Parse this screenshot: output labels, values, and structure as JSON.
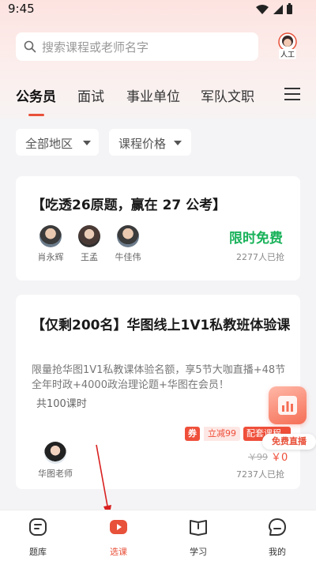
{
  "status_bar": {
    "time": "9:45"
  },
  "search": {
    "placeholder": "搜索课程或老师名字"
  },
  "customer_service": {
    "label": "人工"
  },
  "tabs": [
    {
      "label": "公务员",
      "active": true
    },
    {
      "label": "面试"
    },
    {
      "label": "事业单位"
    },
    {
      "label": "军队文职"
    }
  ],
  "filters": {
    "region": "全部地区",
    "price": "课程价格"
  },
  "card1": {
    "title": "【吃透26原题，赢在 27 公考】",
    "teachers": [
      "肖永辉",
      "王孟",
      "牛佳伟"
    ],
    "price_label": "限时免费",
    "sold": "2277人已抢"
  },
  "card2": {
    "title": "【仅剩200名】华图线上1V1私教班体验课",
    "description": "限量抢华图1V1私教课体验名额，享5节大咖直播+48节全年时政+4000政治理论题+华图在会员！",
    "hours": "共100课时",
    "teacher": "华图老师",
    "coupon_tag": "券",
    "coupon_text": "立减99",
    "combo_tag": "配套课程",
    "old_price": "￥99",
    "new_price": "￥0",
    "sold": "7237人已抢"
  },
  "live_float": {
    "label": "免费直播"
  },
  "bottom_nav": [
    {
      "label": "题库",
      "icon": "question-bank-icon"
    },
    {
      "label": "选课",
      "icon": "play-course-icon",
      "active": true
    },
    {
      "label": "学习",
      "icon": "book-icon"
    },
    {
      "label": "我的",
      "icon": "profile-icon"
    }
  ],
  "colors": {
    "accent": "#e8513a",
    "free": "#19b25a"
  }
}
